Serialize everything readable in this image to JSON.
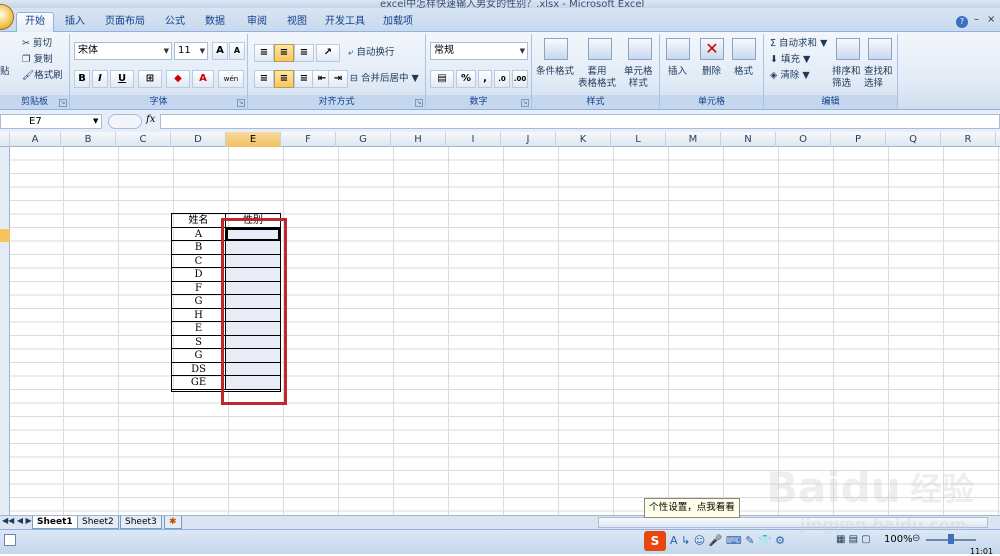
{
  "window": {
    "title": "excel中怎样快速输入男女的性别？.xlsx - Microsoft Excel"
  },
  "tabs": [
    "开始",
    "插入",
    "页面布局",
    "公式",
    "数据",
    "审阅",
    "视图",
    "开发工具",
    "加载项"
  ],
  "ribbon": {
    "clipboard": {
      "paste": "贴",
      "cut": "剪切",
      "copy": "复制",
      "format_painter": "格式刷",
      "label": "剪贴板"
    },
    "font": {
      "name": "宋体",
      "size": "11",
      "bold": "B",
      "italic": "I",
      "underline": "U",
      "label": "字体",
      "inc": "A",
      "dec": "A",
      "wen": "wén",
      "fontcolor": "A"
    },
    "alignment": {
      "wrap": "自动换行",
      "merge": "合并后居中",
      "label": "对齐方式"
    },
    "number": {
      "format": "常规",
      "percent": "%",
      "comma": ",",
      "inc_dec": ".0",
      "dec_dec": ".00",
      "label": "数字"
    },
    "styles": {
      "conditional": "条件格式",
      "table": "套用\n表格格式",
      "cell": "单元格\n样式",
      "label": "样式"
    },
    "cells": {
      "insert": "插入",
      "delete": "删除",
      "format": "格式",
      "label": "单元格"
    },
    "editing": {
      "autosum": "自动求和",
      "fill": "填充",
      "clear": "清除",
      "sort": "排序和\n筛选",
      "find": "查找和\n选择",
      "label": "编辑"
    }
  },
  "formula_bar": {
    "name_box": "E7",
    "fx": "fx",
    "value": ""
  },
  "columns": [
    "A",
    "B",
    "C",
    "D",
    "E",
    "F",
    "G",
    "H",
    "I",
    "J",
    "K",
    "L",
    "M",
    "N",
    "O",
    "P",
    "Q",
    "R"
  ],
  "selected_column": "E",
  "table": {
    "header_name": "姓名",
    "header_gender": "性别",
    "names": [
      "A",
      "B",
      "C",
      "D",
      "F",
      "G",
      "H",
      "E",
      "S",
      "G",
      "DS",
      "GE"
    ]
  },
  "sheets": [
    "Sheet1",
    "Sheet2",
    "Sheet3"
  ],
  "status": {
    "zoom": "100%",
    "time": "11:01"
  },
  "tooltip": "个性设置，点我看看",
  "watermark": {
    "brand": "Baidu",
    "cn": "经验",
    "url": "jingyan.baidu.com"
  },
  "colors": {
    "highlight_border": "#c00000",
    "selected_fill": "#e8ecf6",
    "ribbon_bg": "#dfe9f5"
  }
}
